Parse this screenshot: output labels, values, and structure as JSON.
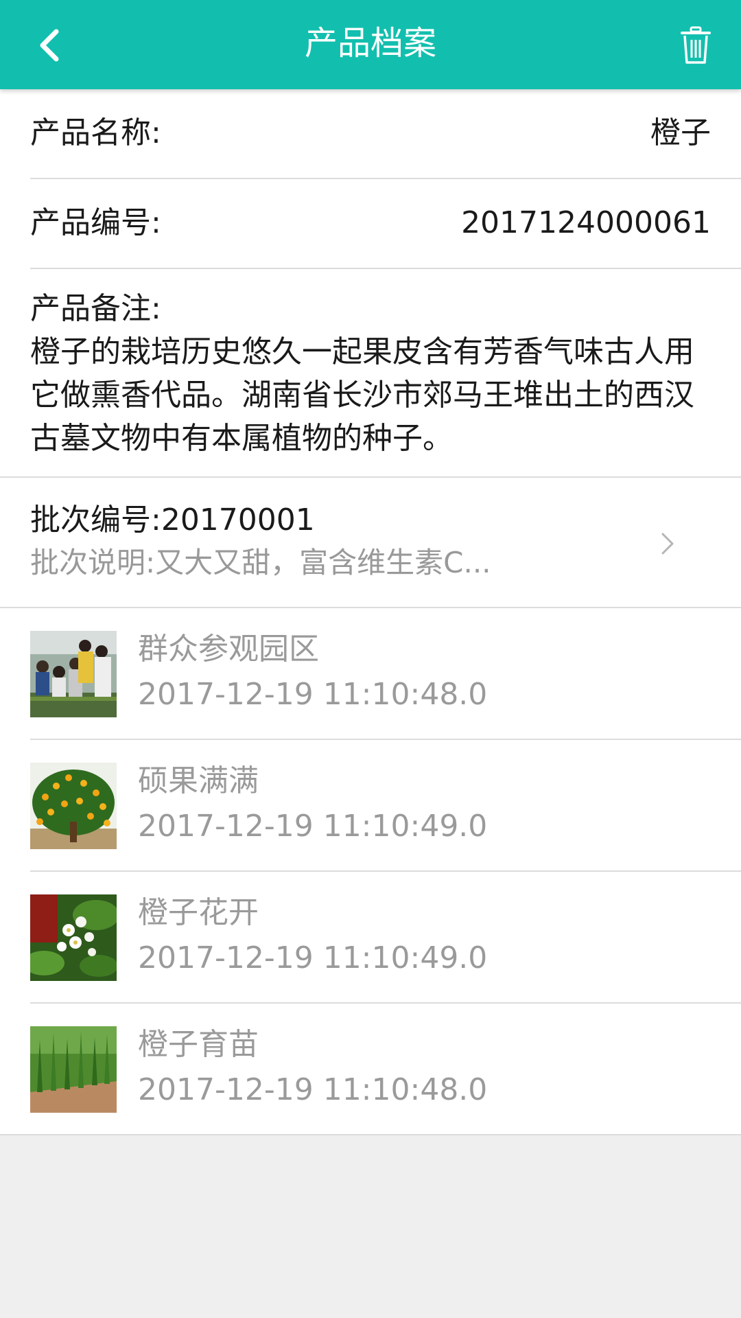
{
  "appbar": {
    "title": "产品档案",
    "back_icon": "chevron-left-icon",
    "delete_icon": "trash-icon",
    "color": "#12bfae"
  },
  "product": {
    "name_label": "产品名称:",
    "name_value": "橙子",
    "code_label": "产品编号:",
    "code_value": "2017124000061",
    "remark_label": "产品备注:",
    "remark_text": "橙子的栽培历史悠久一起果皮含有芳香气味古人用它做熏香代品。湖南省长沙市郊马王堆出土的西汉古墓文物中有本属植物的种子。"
  },
  "batch": {
    "number_text": "批次编号:20170001",
    "description_text": "批次说明:又大又甜，富含维生素C...",
    "chevron_icon": "chevron-right-icon"
  },
  "records": [
    {
      "title": "群众参观园区",
      "time": "2017-12-19 11:10:48.0"
    },
    {
      "title": "硕果满满",
      "time": "2017-12-19 11:10:49.0"
    },
    {
      "title": "橙子花开",
      "time": "2017-12-19 11:10:49.0"
    },
    {
      "title": "橙子育苗",
      "time": "2017-12-19 11:10:48.0"
    }
  ]
}
